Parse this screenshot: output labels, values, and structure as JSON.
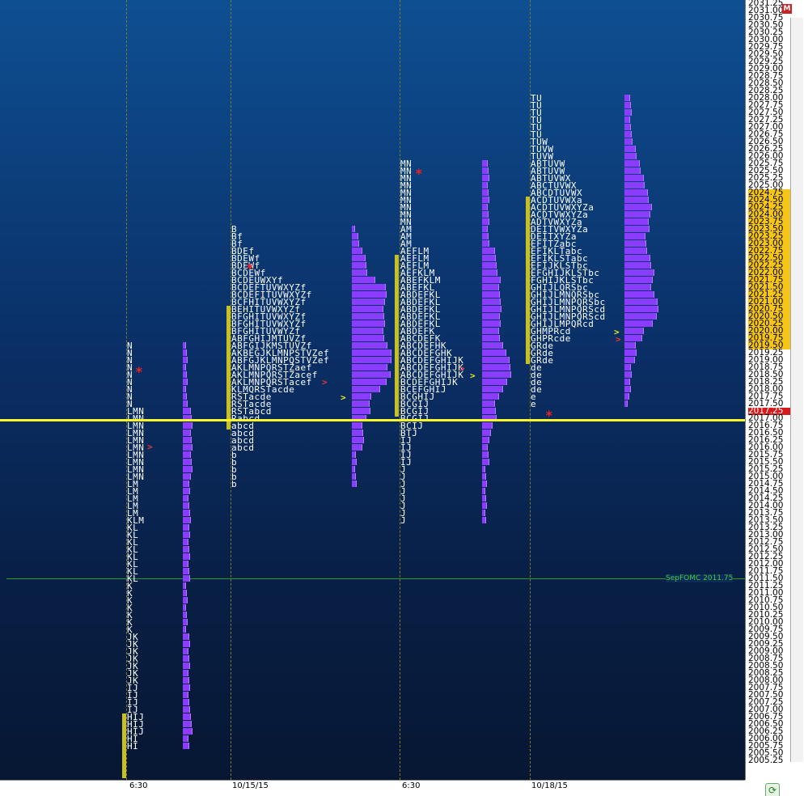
{
  "right_axis_prices": [
    "2031.25",
    "2031.00",
    "2030.75",
    "2030.50",
    "2030.25",
    "2030.00",
    "2029.75",
    "2029.50",
    "2029.25",
    "2029.00",
    "2028.75",
    "2028.50",
    "2028.25",
    "2028.00",
    "2027.75",
    "2027.50",
    "2027.25",
    "2027.00",
    "2026.75",
    "2026.50",
    "2026.25",
    "2026.00",
    "2025.75",
    "2025.50",
    "2025.25",
    "2025.00",
    "2024.75",
    "2024.50",
    "2024.25",
    "2024.00",
    "2023.75",
    "2023.50",
    "2023.25",
    "2023.00",
    "2022.75",
    "2022.50",
    "2022.25",
    "2022.00",
    "2021.75",
    "2021.50",
    "2021.25",
    "2021.00",
    "2020.75",
    "2020.50",
    "2020.25",
    "2020.00",
    "2019.75",
    "2019.50",
    "2019.25",
    "2019.00",
    "2018.75",
    "2018.50",
    "2018.25",
    "2018.00",
    "2017.75",
    "2017.50",
    "2017.25",
    "2017.00",
    "2016.75",
    "2016.50",
    "2016.25",
    "2016.00",
    "2015.75",
    "2015.50",
    "2015.25",
    "2015.00",
    "2014.75",
    "2014.50",
    "2014.25",
    "2014.00",
    "2013.75",
    "2013.50",
    "2013.25",
    "2013.00",
    "2012.75",
    "2012.50",
    "2012.25",
    "2012.00",
    "2011.75",
    "2011.50",
    "2011.25",
    "2011.00",
    "2010.75",
    "2010.50",
    "2010.25",
    "2010.00",
    "2009.75",
    "2009.50",
    "2009.25",
    "2009.00",
    "2008.75",
    "2008.50",
    "2008.25",
    "2008.00",
    "2007.75",
    "2007.50",
    "2007.25",
    "2007.00",
    "2006.75",
    "2006.50",
    "2006.25",
    "2006.00",
    "2005.75",
    "2005.50",
    "2005.25"
  ],
  "highlight_range": [
    "2024.75",
    "2019.50"
  ],
  "current_price": "2017.25",
  "bottom_axis": {
    "t1": "6:30",
    "d1": "10/15/15",
    "t2": "6:30",
    "d2": "10/18/15"
  },
  "fomc_label": "SepFOMC 2011.75",
  "mini_button": "M",
  "refresh_icon": "⟳",
  "profiles": [
    {
      "top_price": "2019.50",
      "letters": [
        "N",
        "N",
        "N",
        "N",
        "N",
        "N",
        "N",
        "N",
        "N",
        "LMN",
        "LMN",
        "LMN",
        "LMN",
        "LMN",
        "LMN",
        "LMN",
        "LMN",
        "LMN",
        "LMN",
        "LM",
        "LM",
        "LM",
        "LM",
        "LM",
        "KLM",
        "KL",
        "KL",
        "KL",
        "KL",
        "KL",
        "KL",
        "KL",
        "KL",
        "K",
        "K",
        "K",
        "K",
        "K",
        "K",
        "K",
        "JK",
        "JK",
        "JK",
        "JK",
        "JK",
        "JK",
        "JK",
        "IJ",
        "IJ",
        "IJ",
        "IJ",
        "HIJ",
        "HIJ",
        "HIJ",
        "HI",
        "HI"
      ]
    },
    {
      "top_price": "2023.50",
      "letters": [
        "B",
        "Bf",
        "Bf",
        "BDEf",
        "BDEWf",
        "BDEWf",
        "BCDEWf",
        "BCDEUWXYf",
        "BCDEFTUVWXYZf",
        "BCDEFITUVWXYZf",
        "BCFHITUVWXYZf",
        "BEHITUVWXYZf",
        "BFGHITUVWXYZf",
        "BFGHITUVWXYZf",
        "BFGHITUVWYZf",
        "ABFGHIJMTUVZf",
        "ABFGIJKMSTUVZf",
        "AKBEGJKLMNPSTVZef",
        "ABFGJKLMNPQSTVZef",
        "AKLMNPQRSTZaef",
        "AKLMNPQRSTZacef",
        "AKLMNPQRSTacef",
        "KLMQRSTacde",
        "RSTacde",
        "RSTacde",
        "RSTabcd",
        "Rabcd",
        "abcd",
        "abcd",
        "abcd",
        "abcd",
        "b",
        "b",
        "b",
        "b",
        "b"
      ]
    },
    {
      "top_price": "2025.75",
      "letters": [
        "MN",
        "MN",
        "MN",
        "MN",
        "MN",
        "MN",
        "MN",
        "MN",
        "MN",
        "AM",
        "AM",
        "AM",
        "AEFLM",
        "AEFLM",
        "AEFLM",
        "AEFKLM",
        "ABEFKLM",
        "ABEFKL",
        "ABDEFKL",
        "ABDEFKL",
        "ABDEFKL",
        "ABDEFKL",
        "ABDEFKL",
        "ABDEFK",
        "ABCDEFK",
        "ABCDEFHK",
        "ABCDEFGHK",
        "ABCDEFGHIJK",
        "ABCDEFGHIJK",
        "ABCDEFGHIJK",
        "BCDEFGHIJK",
        "BCEFGHIJ",
        "BCGHIJ",
        "BCGIJ",
        "BCGIJ",
        "BCGIJ",
        "BCIJ",
        "BTJ",
        "IJ",
        "IJ",
        "IJ",
        "IJ",
        "J",
        "J",
        "J",
        "J",
        "J",
        "J",
        "J",
        "J"
      ]
    },
    {
      "top_price": "2028.00",
      "letters": [
        "TU",
        "TU",
        "TU",
        "TU",
        "TU",
        "TU",
        "TUW",
        "TUVW",
        "TUVW",
        "ABTUVW",
        "ABTUVW",
        "ABTUVWX",
        "ABCTUVWX",
        "ABCDTUVWX",
        "ACDTUVWXa",
        "ACDTUVWXYZa",
        "ACDTVWXYZa",
        "ADTVWXYZa",
        "DEITVWXYZa",
        "DEITXYZa",
        "EFITZabc",
        "EFIKLTabc",
        "EFIKLSTabc",
        "EFIJKLSTbc",
        "EFGHIJKLSTbc",
        "FGHIJKLSTbc",
        "GHIJLQRSbc",
        "GHIJLMNQRSbc",
        "GHIJLMNPQRSbc",
        "GHIJLMNPQRScd",
        "GHIJLMNPQRScd",
        "GHIJLMPQRcd",
        "GHMPRcd",
        "GHPRcde",
        "GRde",
        "GRde",
        "GRde",
        "de",
        "de",
        "de",
        "de",
        "e",
        "e"
      ]
    }
  ]
}
